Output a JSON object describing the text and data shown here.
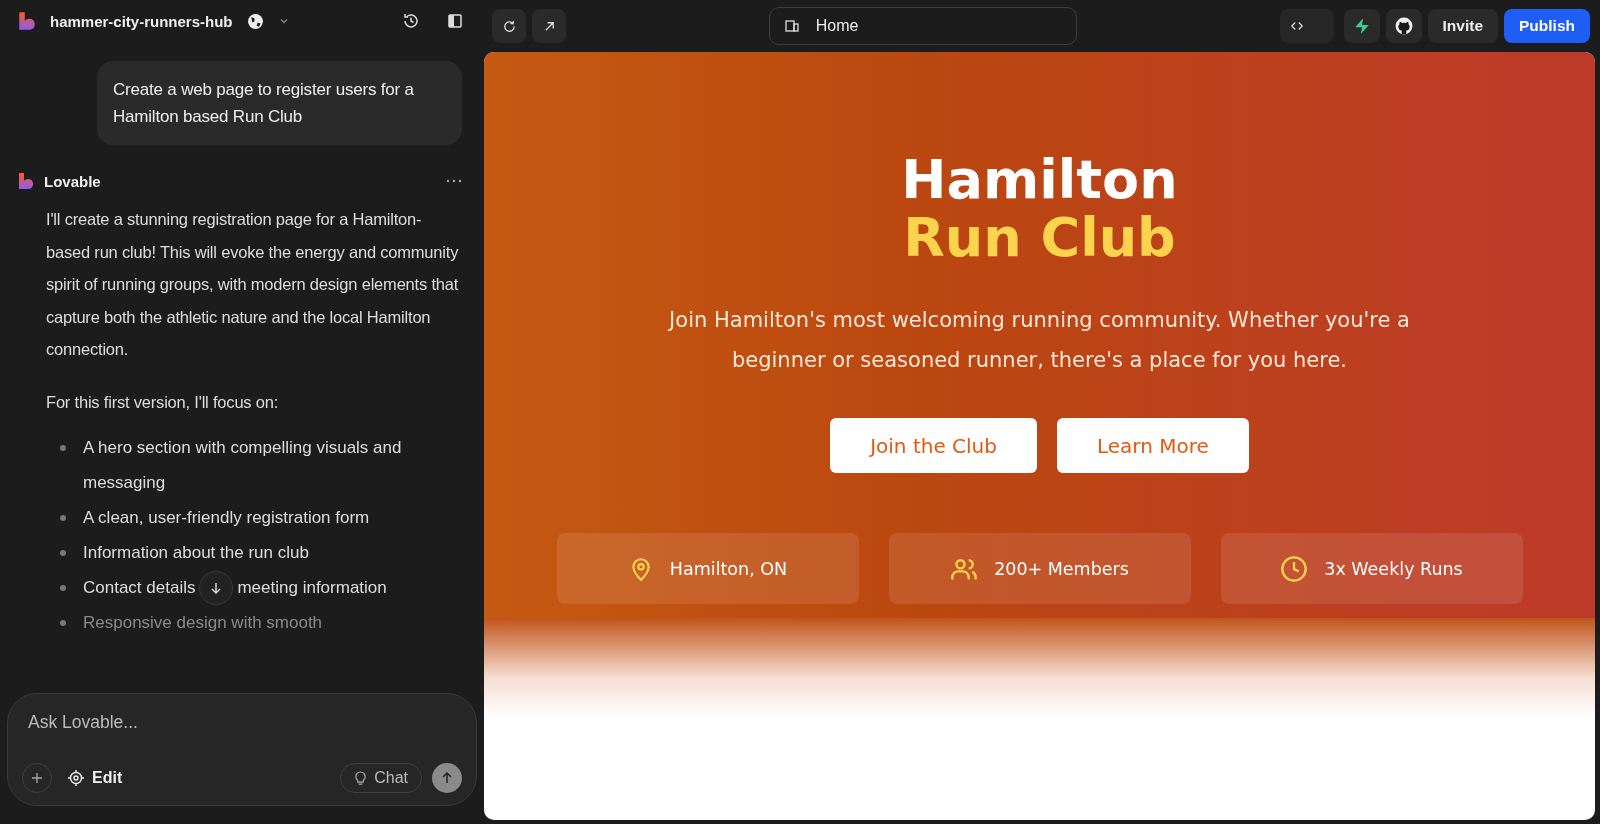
{
  "project": {
    "name": "hammer-city-runners-hub"
  },
  "user_message": "Create a web page to register users for a Hamilton based Run Club",
  "assistant": {
    "name": "Lovable",
    "paragraphs": [
      "I'll create a stunning registration page for a Hamilton-based run club! This will evoke the energy and community spirit of running groups, with modern design elements that capture both the athletic nature and the local Hamilton connection.",
      "For this first version, I'll focus on:"
    ],
    "bullets": [
      {
        "parts": [
          "A hero section with compelling visuals and messaging"
        ],
        "faded": false
      },
      {
        "parts": [
          "A clean, user-friendly registration form"
        ],
        "faded": false
      },
      {
        "parts": [
          "Information about the run club"
        ],
        "faded": false
      },
      {
        "parts": [
          "Contact details",
          "meeting information"
        ],
        "faded": false
      },
      {
        "parts": [
          "Responsive design with smooth"
        ],
        "faded": true
      }
    ]
  },
  "composer": {
    "placeholder": "Ask Lovable...",
    "edit_label": "Edit",
    "chat_label": "Chat"
  },
  "toolbar": {
    "route": "Home",
    "invite": "Invite",
    "publish": "Publish"
  },
  "hero": {
    "title_line1": "Hamilton",
    "title_line2": "Run Club",
    "subtitle": "Join Hamilton's most welcoming running community. Whether you're a beginner or seasoned runner, there's a place for you here.",
    "buttons": [
      "Join the Club",
      "Learn More"
    ],
    "stats": [
      {
        "kind": "location",
        "label": "Hamilton, ON"
      },
      {
        "kind": "members",
        "label": "200+ Members"
      },
      {
        "kind": "schedule",
        "label": "3x Weekly Runs"
      }
    ]
  }
}
